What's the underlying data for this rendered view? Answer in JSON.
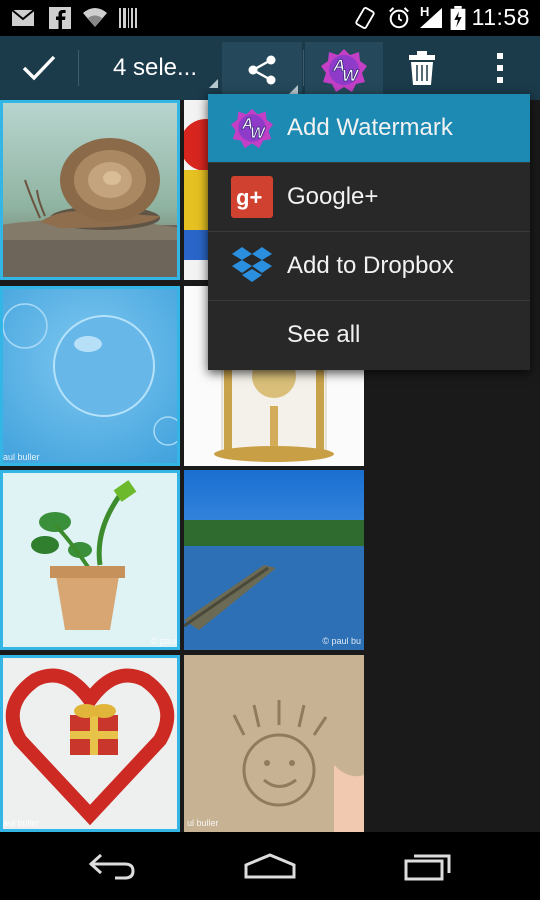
{
  "status_bar": {
    "time": "11:58",
    "network_label": "H",
    "icons": [
      "email-icon",
      "facebook-icon",
      "wifi-icon",
      "barcode-icon",
      "vibrate-icon",
      "alarm-icon",
      "signal-icon",
      "battery-charging-icon"
    ]
  },
  "action_bar": {
    "selection_label": "4 sele...",
    "icons": [
      "check-icon",
      "share-icon",
      "add-watermark-app-icon",
      "trash-icon",
      "overflow-menu-icon"
    ]
  },
  "share_menu": {
    "items": [
      {
        "label": "Add Watermark",
        "icon": "add-watermark-app-icon",
        "icon_text": "AW",
        "active": true
      },
      {
        "label": "Google+",
        "icon": "google-plus-icon",
        "icon_text": "g+"
      },
      {
        "label": "Add to Dropbox",
        "icon": "dropbox-icon"
      },
      {
        "label": "See all",
        "icon": ""
      }
    ]
  },
  "gallery": {
    "tiles": [
      {
        "subject": "snail",
        "selected": true,
        "watermark": ""
      },
      {
        "subject": "toys",
        "selected": false,
        "watermark": ""
      },
      {
        "subject": "bubble",
        "selected": true,
        "watermark": "aul buller"
      },
      {
        "subject": "clock",
        "selected": false,
        "watermark": ""
      },
      {
        "subject": "plant",
        "selected": true,
        "watermark": "© paul"
      },
      {
        "subject": "lake",
        "selected": false,
        "watermark": "© paul bu"
      },
      {
        "subject": "heart",
        "selected": true,
        "watermark": "aul buller"
      },
      {
        "subject": "sand",
        "selected": false,
        "watermark": "ul buller"
      }
    ]
  },
  "nav_bar": {
    "icons": [
      "back-icon",
      "home-icon",
      "recent-apps-icon"
    ]
  },
  "colors": {
    "action_bar": "#1b3a4a",
    "selection_accent": "#33b5e5",
    "menu_highlight": "#1d8ab3",
    "menu_background": "#282828"
  }
}
